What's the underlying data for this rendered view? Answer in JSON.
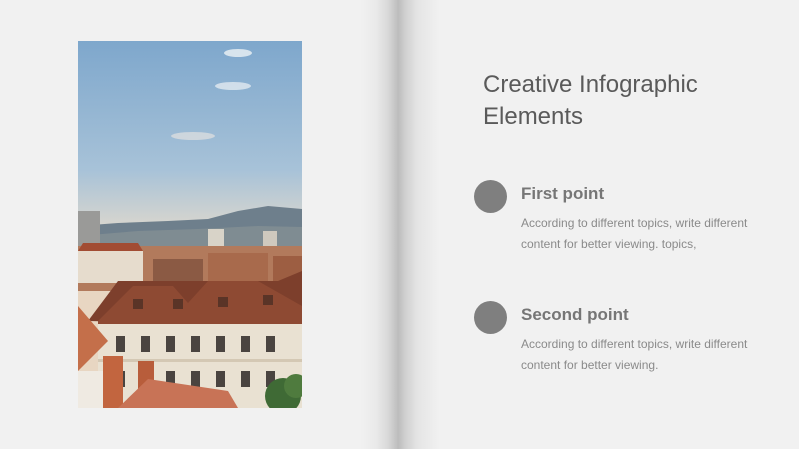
{
  "title": "Creative Infographic Elements",
  "points": [
    {
      "heading": "First point",
      "body": "According to different topics, write different content for better viewing. topics,"
    },
    {
      "heading": "Second point",
      "body": "According to different topics, write different content for better viewing."
    }
  ],
  "colors": {
    "background": "#f1f1f1",
    "dot": "#7f7f7f",
    "title": "#5a5a5a"
  },
  "icons": [
    "bullet-dot-icon"
  ]
}
